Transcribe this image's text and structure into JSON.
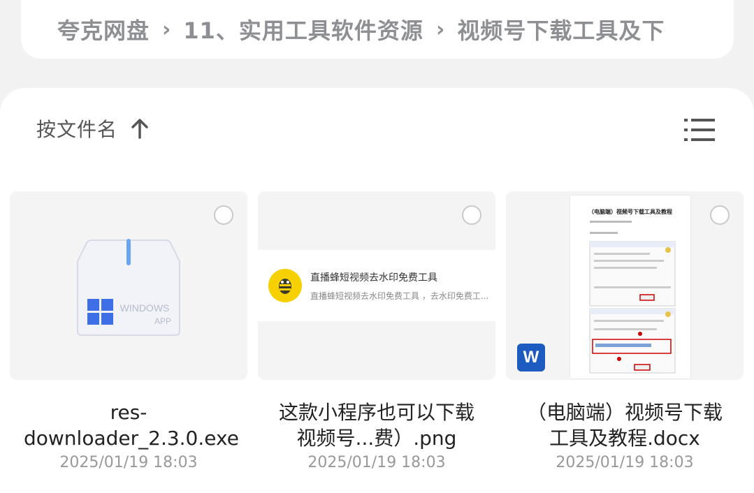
{
  "breadcrumb": {
    "items": [
      "夸克网盘",
      "11、实用工具软件资源",
      "视频号下载工具及下"
    ],
    "separator": "›"
  },
  "toolbar": {
    "sort_label": "按文件名",
    "sort_icon": "arrow-up-icon",
    "view_icon": "list-view-icon"
  },
  "files": [
    {
      "name": "res-downloader_2.3.0.exe",
      "date": "2025/01/19 18:03",
      "thumb_type": "app",
      "thumb_text": "WINDOWS APP"
    },
    {
      "name": "这款小程序也可以下载视频号...费）.png",
      "date": "2025/01/19 18:03",
      "thumb_type": "image",
      "thumb_title": "直播蜂短视频去水印免费工具",
      "thumb_desc": "直播蜂短视频去水印免费工具 ，去水印免费工..."
    },
    {
      "name": "（电脑端）视频号下载工具及教程.docx",
      "date": "2025/01/19 18:03",
      "thumb_type": "document",
      "thumb_title": "（电脑端）视频号下载工具及教程",
      "badge": "W"
    }
  ],
  "colors": {
    "background": "#f2f2f3",
    "text_muted": "#8e8f93",
    "word_blue": "#1d5bc0",
    "bee_yellow": "#f7d000"
  }
}
